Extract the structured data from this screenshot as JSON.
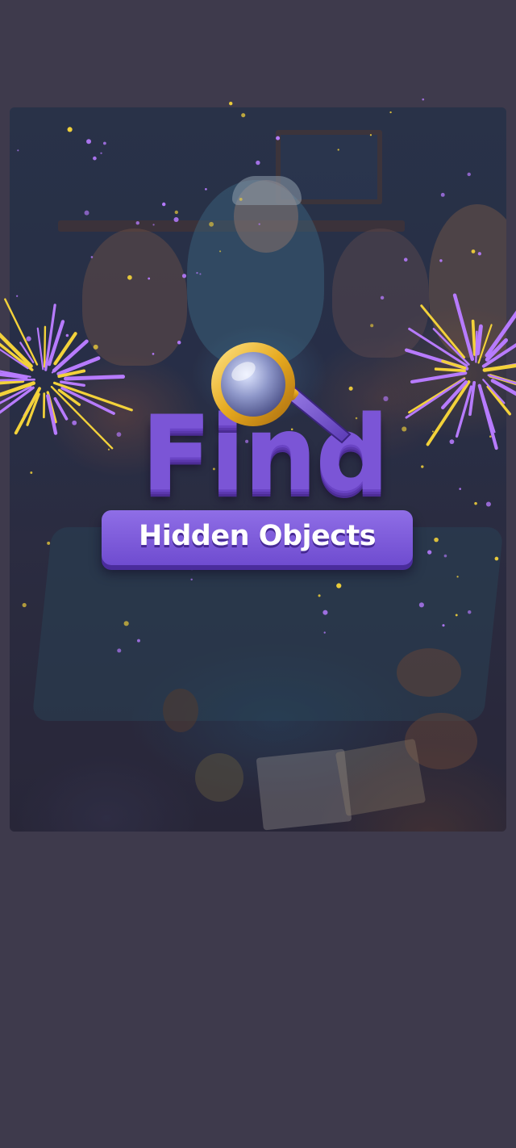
{
  "colors": {
    "background": "#3e3a4c",
    "logo_purple": "#7b55d6",
    "banner_purple": "#8f6ee6",
    "subtitle_text": "#ffffff",
    "firework_purple": "#b77bff",
    "firework_yellow": "#f3d23a"
  },
  "splash": {
    "title_word": "Find",
    "subtitle": "Hidden Objects",
    "icon": "magnifying-glass-icon"
  }
}
